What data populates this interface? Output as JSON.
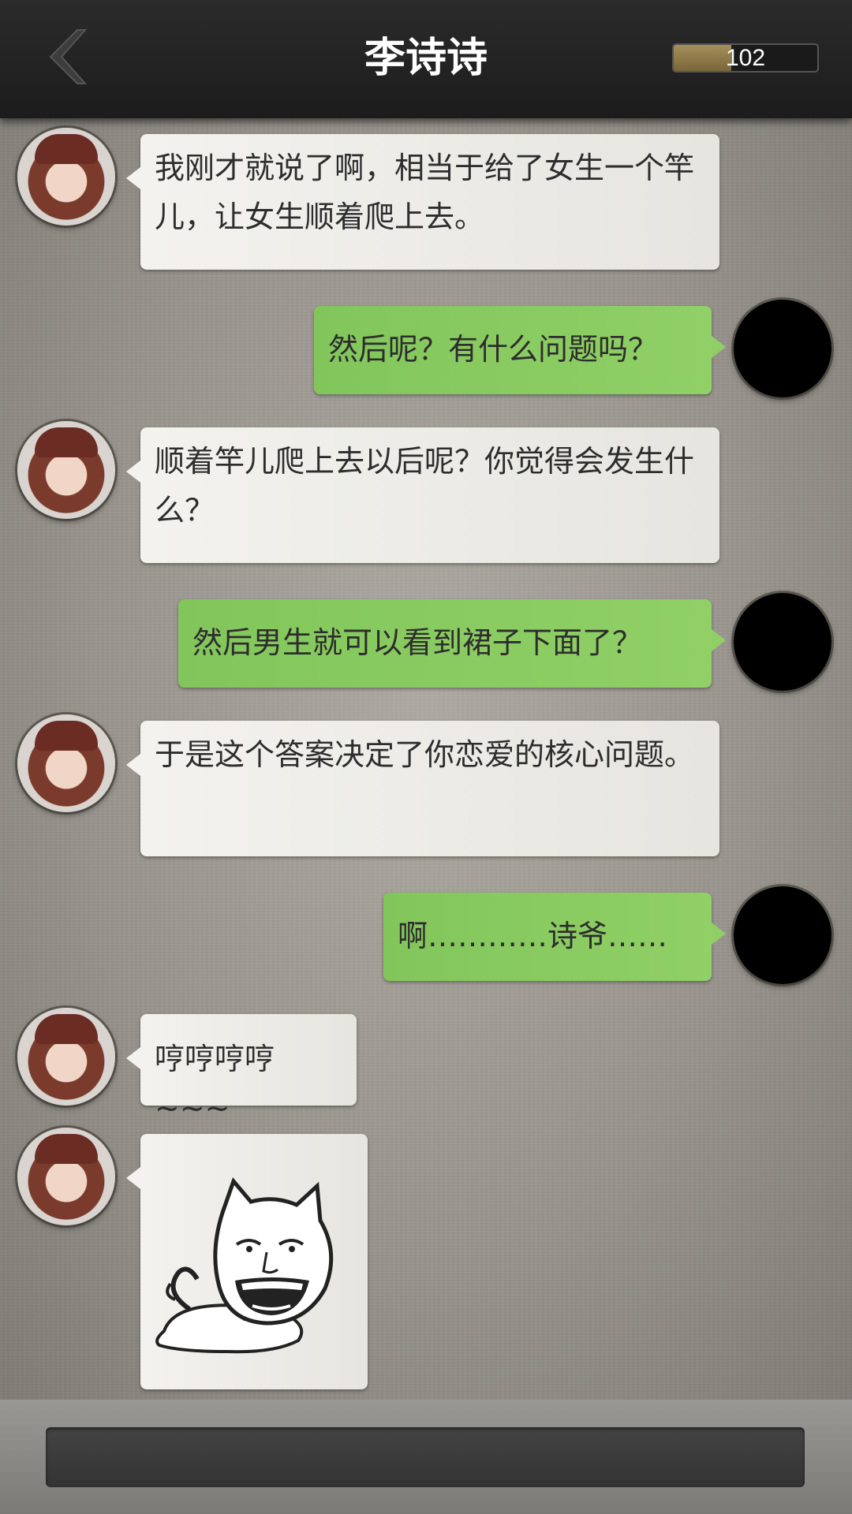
{
  "header": {
    "title": "李诗诗",
    "score": "102",
    "score_fill": 0.4,
    "back_icon": "chevron-left-icon"
  },
  "messages": [
    {
      "side": "left",
      "text": "我刚才就说了啊，相当于给了女生一个竿儿，让女生顺着爬上去。"
    },
    {
      "side": "right",
      "text": "然后呢？有什么问题吗？"
    },
    {
      "side": "left",
      "text": "顺着竿儿爬上去以后呢？你觉得会发生什么？"
    },
    {
      "side": "right",
      "text": "然后男生就可以看到裙子下面了？"
    },
    {
      "side": "left",
      "text": "于是这个答案决定了你恋爱的核心问题。"
    },
    {
      "side": "right",
      "text": "啊…………诗爷……"
    },
    {
      "side": "left",
      "text": "哼哼哼哼~~~"
    },
    {
      "side": "left",
      "sticker": "laughing-cat-sticker"
    }
  ],
  "input": {
    "placeholder": ""
  },
  "colors": {
    "header_bg": "#222222",
    "my_bubble": "#8ccb62",
    "their_bubble": "#ecebe7",
    "title_text": "#ffffff"
  }
}
